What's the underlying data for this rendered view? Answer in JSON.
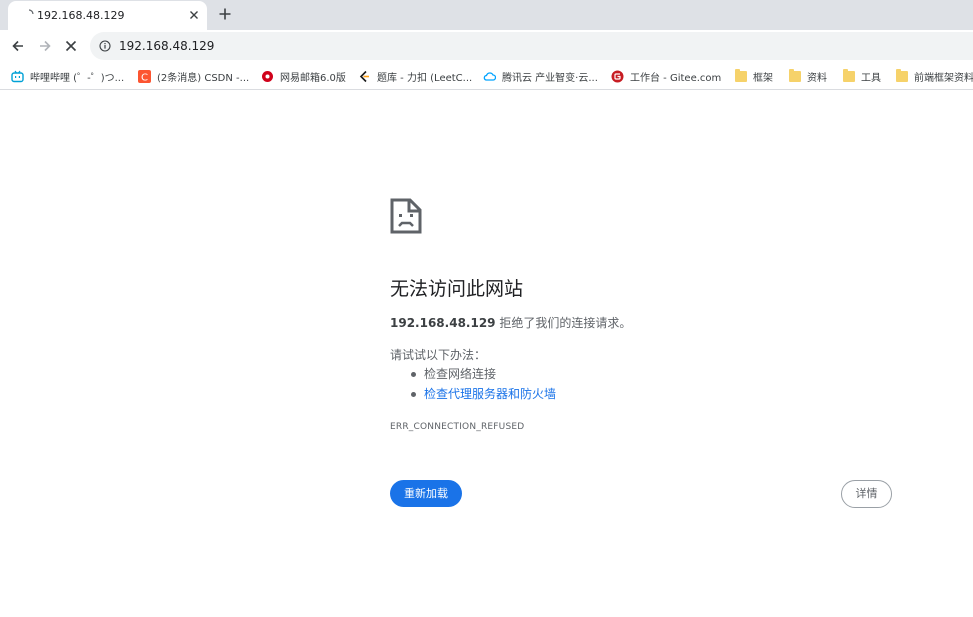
{
  "tab": {
    "title": "192.168.48.129"
  },
  "toolbar": {
    "url": "192.168.48.129"
  },
  "bookmarks": [
    {
      "label": "哔哩哔哩 (゜-゜)つ...",
      "icon": "bilibili-icon",
      "color": "#00a1d6"
    },
    {
      "label": "(2条消息) CSDN -...",
      "icon": "csdn-icon",
      "color": "#fc5531"
    },
    {
      "label": "网易邮箱6.0版",
      "icon": "netease-mail-icon",
      "color": "#d0021b"
    },
    {
      "label": "题库 - 力扣 (LeetC...",
      "icon": "leetcode-icon",
      "color": "#ffa116"
    },
    {
      "label": "腾讯云 产业智变·云...",
      "icon": "tencent-cloud-icon",
      "color": "#00a3ff"
    },
    {
      "label": "工作台 - Gitee.com",
      "icon": "gitee-icon",
      "color": "#c71d23"
    },
    {
      "label": "框架",
      "icon": "folder-icon",
      "color": "#f6d26a"
    },
    {
      "label": "资料",
      "icon": "folder-icon",
      "color": "#f6d26a"
    },
    {
      "label": "工具",
      "icon": "folder-icon",
      "color": "#f6d26a"
    },
    {
      "label": "前端框架资料",
      "icon": "folder-icon",
      "color": "#f6d26a"
    }
  ],
  "error": {
    "title": "无法访问此网站",
    "host": "192.168.48.129",
    "message": " 拒绝了我们的连接请求。",
    "try_label": "请试试以下办法：",
    "suggestions": [
      "检查网络连接",
      "检查代理服务器和防火墙"
    ],
    "code": "ERR_CONNECTION_REFUSED",
    "reload_label": "重新加载",
    "details_label": "详情"
  },
  "colors": {
    "accent": "#1a73e8",
    "tabstrip": "#dee1e6",
    "omnibox": "#f1f3f4"
  }
}
